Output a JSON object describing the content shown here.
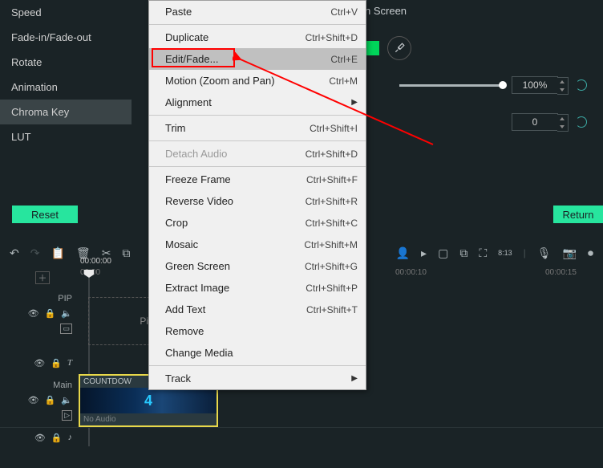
{
  "sidebar": {
    "items": [
      {
        "label": "Speed"
      },
      {
        "label": "Fade-in/Fade-out"
      },
      {
        "label": "Rotate"
      },
      {
        "label": "Animation"
      },
      {
        "label": "Chroma Key",
        "selected": true
      },
      {
        "label": "LUT"
      }
    ]
  },
  "right_panel": {
    "header": "n Screen",
    "tolerance_value": "100%",
    "offset_value": "0",
    "color_hex": "#00d55a"
  },
  "buttons": {
    "reset": "Reset",
    "return": "Return"
  },
  "context_menu": {
    "items": [
      {
        "label": "Paste",
        "shortcut": "Ctrl+V"
      },
      {
        "sep": true
      },
      {
        "label": "Duplicate",
        "shortcut": "Ctrl+Shift+D"
      },
      {
        "label": "Edit/Fade...",
        "shortcut": "Ctrl+E",
        "highlighted": true
      },
      {
        "label": "Motion (Zoom and Pan)",
        "shortcut": "Ctrl+M"
      },
      {
        "label": "Alignment",
        "submenu": true
      },
      {
        "sep": true
      },
      {
        "label": "Trim",
        "shortcut": "Ctrl+Shift+I"
      },
      {
        "sep": true
      },
      {
        "label": "Detach Audio",
        "shortcut": "Ctrl+Shift+D",
        "disabled": true
      },
      {
        "sep": true
      },
      {
        "label": "Freeze Frame",
        "shortcut": "Ctrl+Shift+F"
      },
      {
        "label": "Reverse Video",
        "shortcut": "Ctrl+Shift+R"
      },
      {
        "label": "Crop",
        "shortcut": "Ctrl+Shift+C"
      },
      {
        "label": "Mosaic",
        "shortcut": "Ctrl+Shift+M"
      },
      {
        "label": "Green Screen",
        "shortcut": "Ctrl+Shift+G"
      },
      {
        "label": "Extract Image",
        "shortcut": "Ctrl+Shift+P"
      },
      {
        "label": "Add Text",
        "shortcut": "Ctrl+Shift+T"
      },
      {
        "label": "Remove"
      },
      {
        "label": "Change Media"
      },
      {
        "sep": true
      },
      {
        "label": "Track",
        "submenu": true
      }
    ]
  },
  "timeline": {
    "playhead_time": "00:00:00",
    "ruler": [
      "00:00",
      "00:00:10",
      "00:00:15"
    ],
    "pip_track": {
      "name": "PIP",
      "placeholder": "Picture"
    },
    "main_track": {
      "name": "Main"
    },
    "clip": {
      "title": "COUNTDOW",
      "thumb_digit": "4",
      "audio_label": "No Audio"
    }
  }
}
